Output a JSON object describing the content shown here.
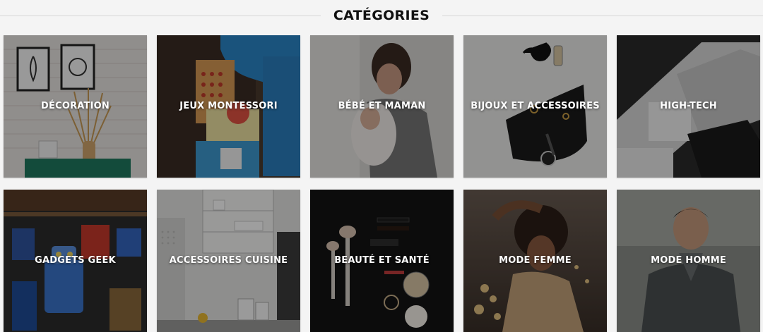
{
  "section": {
    "title": "CATÉGORIES"
  },
  "categories": [
    {
      "label": "DÉCORATION",
      "icon": "decoration-photo"
    },
    {
      "label": "JEUX MONTESSORI",
      "icon": "montessori-photo"
    },
    {
      "label": "BÉBÉ ET MAMAN",
      "icon": "baby-mother-photo"
    },
    {
      "label": "BIJOUX ET ACCESSOIRES",
      "icon": "jewelry-photo"
    },
    {
      "label": "HIGH-TECH",
      "icon": "high-tech-photo"
    },
    {
      "label": "GADGETS GEEK",
      "icon": "geek-gadgets-photo"
    },
    {
      "label": "ACCESSOIRES CUISINE",
      "icon": "kitchen-photo"
    },
    {
      "label": "BEAUTÉ ET SANTÉ",
      "icon": "beauty-health-photo"
    },
    {
      "label": "MODE FEMME",
      "icon": "women-fashion-photo"
    },
    {
      "label": "MODE HOMME",
      "icon": "men-fashion-photo"
    }
  ],
  "colors": {
    "background": "#f4f4f4",
    "heading_text": "#111111",
    "label_text": "#ffffff",
    "divider": "#d6d6d6"
  }
}
